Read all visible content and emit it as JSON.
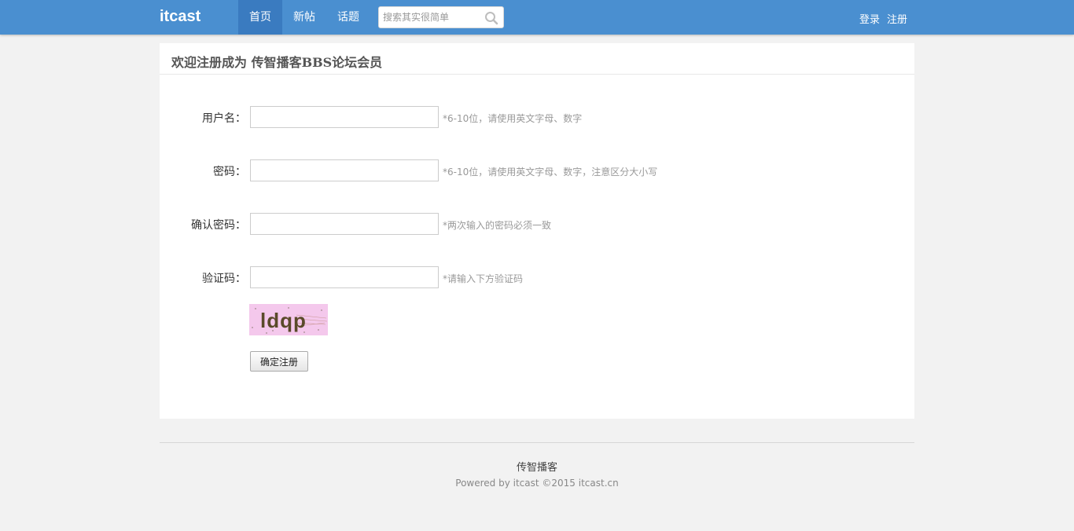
{
  "brand": {
    "logo": "itcast"
  },
  "nav": {
    "items": [
      {
        "label": "首页"
      },
      {
        "label": "新帖"
      },
      {
        "label": "话题"
      }
    ],
    "search_placeholder": "搜索其实很简单",
    "login": "登录",
    "register": "注册"
  },
  "page": {
    "title": "欢迎注册成为 传智播客BBS论坛会员"
  },
  "form": {
    "fields": [
      {
        "label": "用户名：",
        "value": "",
        "hint": "*6-10位，请使用英文字母、数字"
      },
      {
        "label": "密码：",
        "value": "",
        "hint": "*6-10位，请使用英文字母、数字，注意区分大小写"
      },
      {
        "label": "确认密码：",
        "value": "",
        "hint": "*两次输入的密码必须一致"
      },
      {
        "label": "验证码：",
        "value": "",
        "hint": "*请输入下方验证码"
      }
    ],
    "captcha_text": "ldqp",
    "submit_label": "确定注册"
  },
  "footer": {
    "brand": "传智播客",
    "powered": "Powered by itcast ©2015 itcast.cn"
  },
  "colors": {
    "topbar": "#4a8fd0",
    "nav_active": "#3a7bc0",
    "captcha_bg": "#f4c8ec",
    "captcha_text": "#5a4a2a"
  }
}
